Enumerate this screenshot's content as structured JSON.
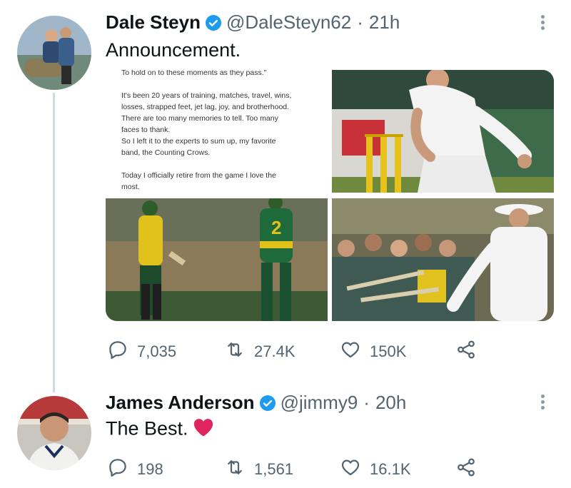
{
  "tweets": [
    {
      "name": "Dale Steyn",
      "handle": "@DaleSteyn62",
      "time": "21h",
      "text": "Announcement.",
      "media_doc": {
        "lines": [
          "To hold on to these moments as they pass.\"",
          "",
          "It's been 20 years of training, matches, travel, wins,",
          "losses, strapped feet, jet lag, joy, and brotherhood.",
          "There are too many memories to tell. Too many",
          "faces to thank.",
          "So I left it to the experts to sum up, my favorite",
          "band, the Counting Crows.",
          "",
          "Today I officially retire from the game I love the",
          "most."
        ]
      },
      "stats": {
        "replies": "7,035",
        "retweets": "27.4K",
        "likes": "150K"
      }
    },
    {
      "name": "James Anderson",
      "handle": "@jimmy9",
      "time": "20h",
      "text": "The Best.",
      "stats": {
        "replies": "198",
        "retweets": "1,561",
        "likes": "16.1K"
      }
    }
  ],
  "colors": {
    "verified": "#1d9bf0",
    "muted": "#536471",
    "heart": "#e0245e"
  },
  "icons": [
    "verified-badge-icon",
    "more-icon",
    "reply-icon",
    "retweet-icon",
    "like-icon",
    "share-icon",
    "red-heart-emoji"
  ]
}
